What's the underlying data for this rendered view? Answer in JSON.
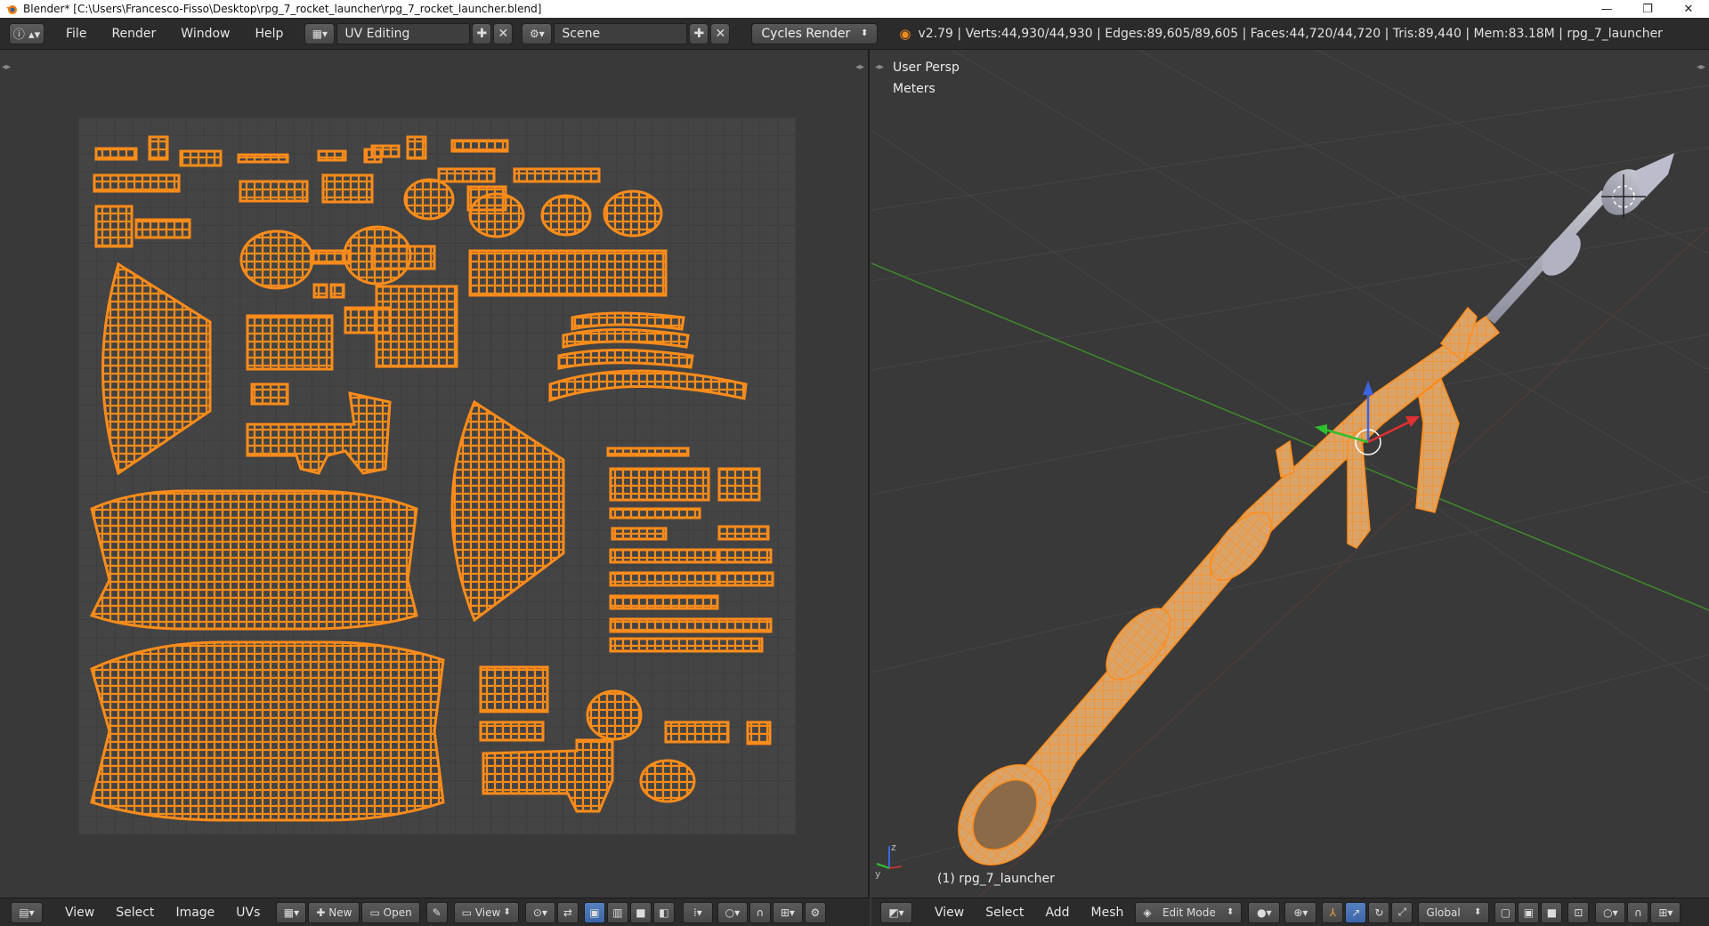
{
  "window": {
    "title": "Blender* [C:\\Users\\Francesco-Fisso\\Desktop\\rpg_7_rocket_launcher\\rpg_7_rocket_launcher.blend]",
    "controls": [
      "—",
      "❐",
      "✕"
    ]
  },
  "info_header": {
    "menus": [
      "File",
      "Render",
      "Window",
      "Help"
    ],
    "screen_layout": "UV Editing",
    "scene": "Scene",
    "render_engine": "Cycles Render",
    "stats": "v2.79 | Verts:44,930/44,930 | Edges:89,605/89,605 | Faces:44,720/44,720 | Tris:89,440 | Mem:83.18M | rpg_7_launcher"
  },
  "uv_editor": {
    "menus": [
      "View",
      "Select",
      "Image",
      "UVs"
    ],
    "new_label": "New",
    "open_label": "Open",
    "view_label": "View"
  },
  "viewport": {
    "view_name": "User Persp",
    "units": "Meters",
    "object_label": "(1) rpg_7_launcher",
    "menus": [
      "View",
      "Select",
      "Add",
      "Mesh"
    ],
    "mode": "Edit Mode",
    "orientation": "Global"
  },
  "colors": {
    "uv_orange": "#ff8c1a",
    "mesh_face": "#d9a46a",
    "grid_red": "#8a3a3a",
    "grid_green": "#3e8a2a",
    "header_bg": "#2b2b2b",
    "active_blue": "#4a72b5"
  }
}
